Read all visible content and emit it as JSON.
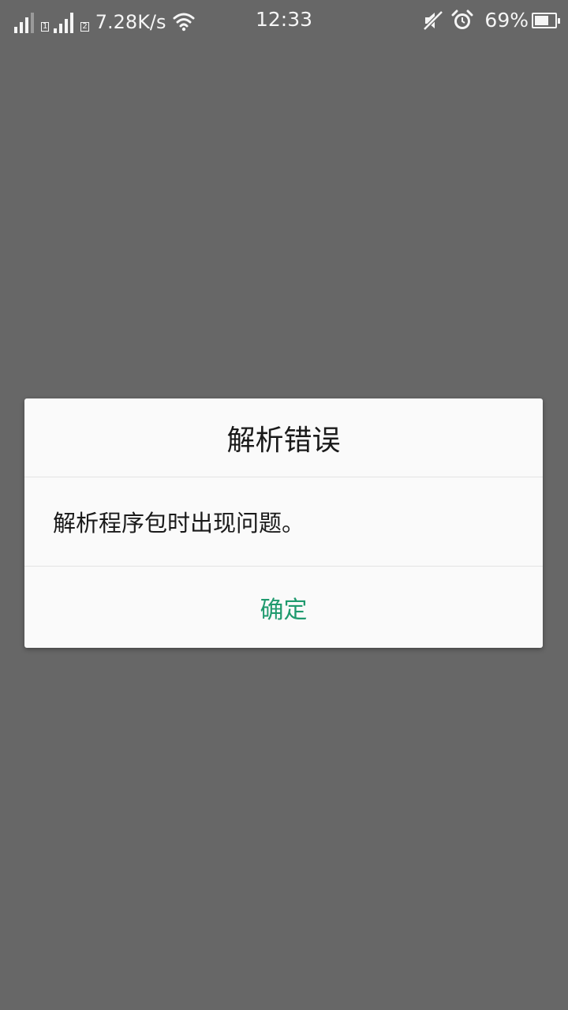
{
  "status_bar": {
    "sim1": "1",
    "sim2": "2",
    "net_speed": "7.28K/s",
    "time": "12:33",
    "battery_percent_text": "69%",
    "battery_level": 0.69,
    "icons": [
      "signal-sim1-icon",
      "signal-sim2-icon",
      "wifi-icon",
      "mute-icon",
      "alarm-icon",
      "battery-icon"
    ]
  },
  "dialog": {
    "title": "解析错误",
    "message": "解析程序包时出现问题。",
    "confirm_label": "确定",
    "accent_color": "#1f9a6e"
  }
}
